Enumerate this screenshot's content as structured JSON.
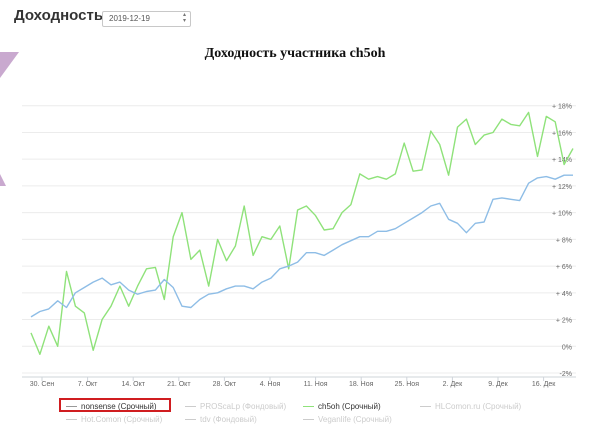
{
  "header": {
    "title": "Доходность",
    "date_value": "2019-12-19"
  },
  "chart_data": {
    "type": "line",
    "title": "Доходность участника ch5oh",
    "x_tick_labels": [
      "30. Сен",
      "7. Окт",
      "14. Окт",
      "21. Окт",
      "28. Окт",
      "4. Ноя",
      "11. Ноя",
      "18. Ноя",
      "25. Ноя",
      "2. Дек",
      "9. Дек",
      "16. Дек"
    ],
    "y_tick_labels": [
      "+ 18%",
      "+ 16%",
      "+ 14%",
      "+ 12%",
      "+ 10%",
      "+ 8%",
      "+ 6%",
      "+ 4%",
      "+ 2%",
      "0%",
      "-2%"
    ],
    "ylim": [
      -2,
      20
    ],
    "colors": {
      "green": "#8fe27a",
      "blue": "#8ebde6"
    },
    "series": [
      {
        "name": "ch5oh (Срочный)",
        "color": "#8fe27a",
        "values": [
          1.0,
          -0.6,
          1.5,
          0.0,
          5.6,
          3.0,
          2.5,
          -0.3,
          2.0,
          3.0,
          4.5,
          3.0,
          4.5,
          5.8,
          5.9,
          3.5,
          8.2,
          10.0,
          6.5,
          7.2,
          4.5,
          8.0,
          6.4,
          7.5,
          10.5,
          6.8,
          8.2,
          8.0,
          9.0,
          5.8,
          10.2,
          10.5,
          9.8,
          8.7,
          8.8,
          10.0,
          10.6,
          12.9,
          12.5,
          12.7,
          12.5,
          12.9,
          15.2,
          13.1,
          13.2,
          16.1,
          15.1,
          12.8,
          16.4,
          17.0,
          15.1,
          15.8,
          16.0,
          17.0,
          16.6,
          16.5,
          17.5,
          14.2,
          17.2,
          16.8,
          13.6,
          14.8
        ]
      },
      {
        "name": "HLComon.ru (Срочный)",
        "color": "#8ebde6",
        "values": [
          2.2,
          2.6,
          2.8,
          3.4,
          2.9,
          4.0,
          4.4,
          4.8,
          5.1,
          4.6,
          4.8,
          4.2,
          3.9,
          4.1,
          4.2,
          5.0,
          4.4,
          3.0,
          2.9,
          3.5,
          3.9,
          4.0,
          4.3,
          4.5,
          4.5,
          4.3,
          4.8,
          5.1,
          5.8,
          6.0,
          6.3,
          7.0,
          7.0,
          6.8,
          7.2,
          7.6,
          7.9,
          8.2,
          8.2,
          8.6,
          8.6,
          8.8,
          9.2,
          9.6,
          10.0,
          10.5,
          10.7,
          9.5,
          9.2,
          8.5,
          9.2,
          9.3,
          11.0,
          11.1,
          11.0,
          10.9,
          12.2,
          12.6,
          12.7,
          12.5,
          12.8,
          12.8
        ]
      }
    ]
  },
  "legend": {
    "items": [
      {
        "label": "nonsense (Срочный)",
        "state": "active"
      },
      {
        "label": "PROScaLp (Фондовый)",
        "state": "dim"
      },
      {
        "label": "ch5oh (Срочный)",
        "state": "active"
      },
      {
        "label": "HLComon.ru (Срочный)",
        "state": "dim"
      },
      {
        "label": "Hot.Comon (Срочный)",
        "state": "dim"
      },
      {
        "label": "tdv (Фондовый)",
        "state": "dim"
      },
      {
        "label": "Veganlife (Срочный)",
        "state": "dim"
      }
    ]
  }
}
